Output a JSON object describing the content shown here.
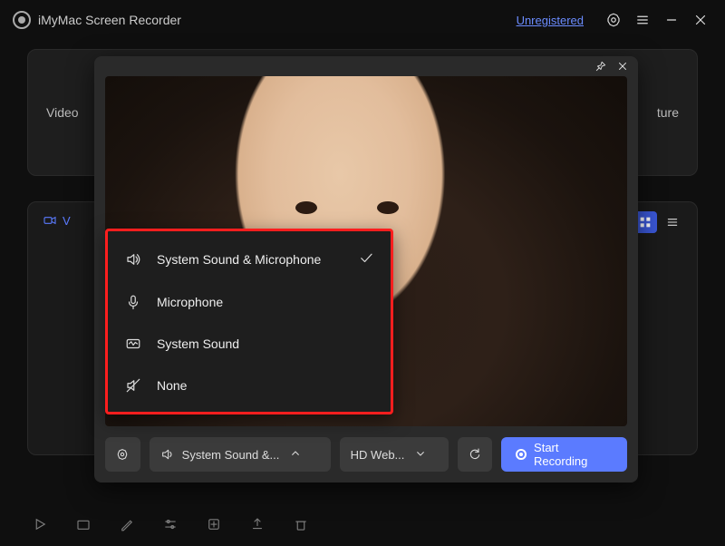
{
  "app": {
    "title": "iMyMac Screen Recorder"
  },
  "titlebar": {
    "unregistered": "Unregistered"
  },
  "modes": {
    "left": "Video",
    "right": "ture"
  },
  "section2": {
    "head_label": "V"
  },
  "overlay": {
    "settings_label": "",
    "audio_select": "System Sound &...",
    "camera_select": "HD Web...",
    "start_label": "Start Recording"
  },
  "audio_menu": {
    "items": [
      {
        "label": "System Sound & Microphone",
        "icon": "speaker",
        "selected": true
      },
      {
        "label": "Microphone",
        "icon": "mic",
        "selected": false
      },
      {
        "label": "System Sound",
        "icon": "system",
        "selected": false
      },
      {
        "label": "None",
        "icon": "mute",
        "selected": false
      }
    ]
  }
}
